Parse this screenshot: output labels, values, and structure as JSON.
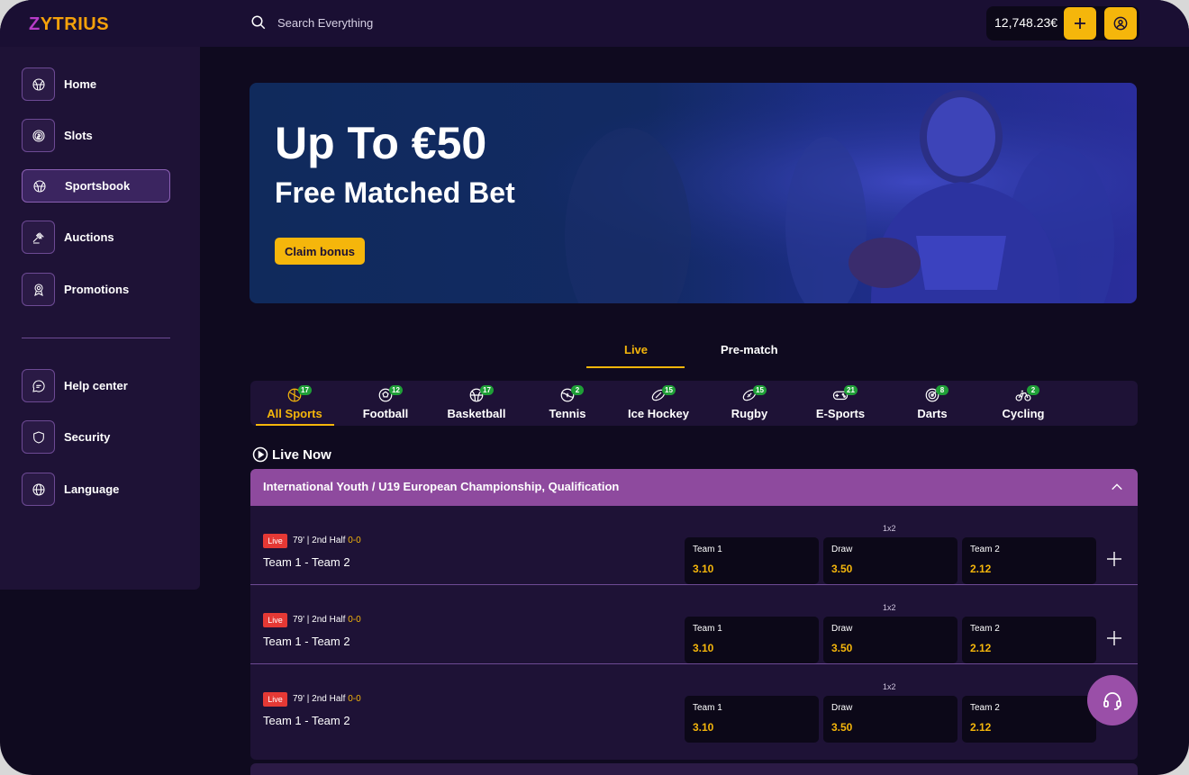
{
  "brand": {
    "name": "YTRIUS",
    "initial": "Z"
  },
  "header": {
    "search_placeholder": "Search Everything",
    "balance": "12,748.23€"
  },
  "sidebar": {
    "items": [
      {
        "label": "Home",
        "icon": "basketball-icon"
      },
      {
        "label": "Slots",
        "icon": "coin-icon"
      },
      {
        "label": "Sportsbook",
        "icon": "basketball-icon",
        "active": true
      },
      {
        "label": "Auctions",
        "icon": "gavel-icon"
      },
      {
        "label": "Promotions",
        "icon": "award-icon"
      }
    ],
    "secondary_items": [
      {
        "label": "Help center",
        "icon": "chat-icon"
      },
      {
        "label": "Security",
        "icon": "shield-icon"
      },
      {
        "label": "Language",
        "icon": "globe-icon"
      }
    ]
  },
  "banner": {
    "title": "Up To €50",
    "subtitle": "Free Matched Bet",
    "cta": "Claim bonus"
  },
  "tabs": [
    {
      "label": "Live",
      "active": true
    },
    {
      "label": "Pre-match",
      "active": false
    }
  ],
  "sports": [
    {
      "label": "All Sports",
      "count": "17",
      "icon": "all-sports-icon",
      "active": true
    },
    {
      "label": "Football",
      "count": "12",
      "icon": "football-icon"
    },
    {
      "label": "Basketball",
      "count": "17",
      "icon": "basketball-icon"
    },
    {
      "label": "Tennis",
      "count": "2",
      "icon": "tennis-icon"
    },
    {
      "label": "Ice Hockey",
      "count": "15",
      "icon": "ice-hockey-icon"
    },
    {
      "label": "Rugby",
      "count": "15",
      "icon": "rugby-icon"
    },
    {
      "label": "E-Sports",
      "count": "21",
      "icon": "gamepad-icon"
    },
    {
      "label": "Darts",
      "count": "8",
      "icon": "darts-icon"
    },
    {
      "label": "Cycling",
      "count": "2",
      "icon": "bicycle-icon"
    }
  ],
  "live_now": {
    "label": "Live Now"
  },
  "league": {
    "name": "International Youth / U19 European Championship, Qualification"
  },
  "matches": [
    {
      "badge": "Live",
      "time": "79' | 2nd Half",
      "score": "0-0",
      "teams": "Team 1 - Team 2",
      "market": "1x2",
      "odds": [
        {
          "label": "Team 1",
          "value": "3.10"
        },
        {
          "label": "Draw",
          "value": "3.50"
        },
        {
          "label": "Team 2",
          "value": "2.12"
        }
      ]
    },
    {
      "badge": "Live",
      "time": "79' | 2nd Half",
      "score": "0-0",
      "teams": "Team 1 - Team 2",
      "market": "1x2",
      "odds": [
        {
          "label": "Team 1",
          "value": "3.10"
        },
        {
          "label": "Draw",
          "value": "3.50"
        },
        {
          "label": "Team 2",
          "value": "2.12"
        }
      ]
    },
    {
      "badge": "Live",
      "time": "79' | 2nd Half",
      "score": "0-0",
      "teams": "Team 1 - Team 2",
      "market": "1x2",
      "odds": [
        {
          "label": "Team 1",
          "value": "3.10"
        },
        {
          "label": "Draw",
          "value": "3.50"
        },
        {
          "label": "Team 2",
          "value": "2.12"
        }
      ]
    }
  ],
  "colors": {
    "accent": "#f5b60b",
    "brand_purple": "#8e4a9e",
    "live_red": "#e53935",
    "count_green": "#1f9f37",
    "background": "#0f0a1f"
  }
}
